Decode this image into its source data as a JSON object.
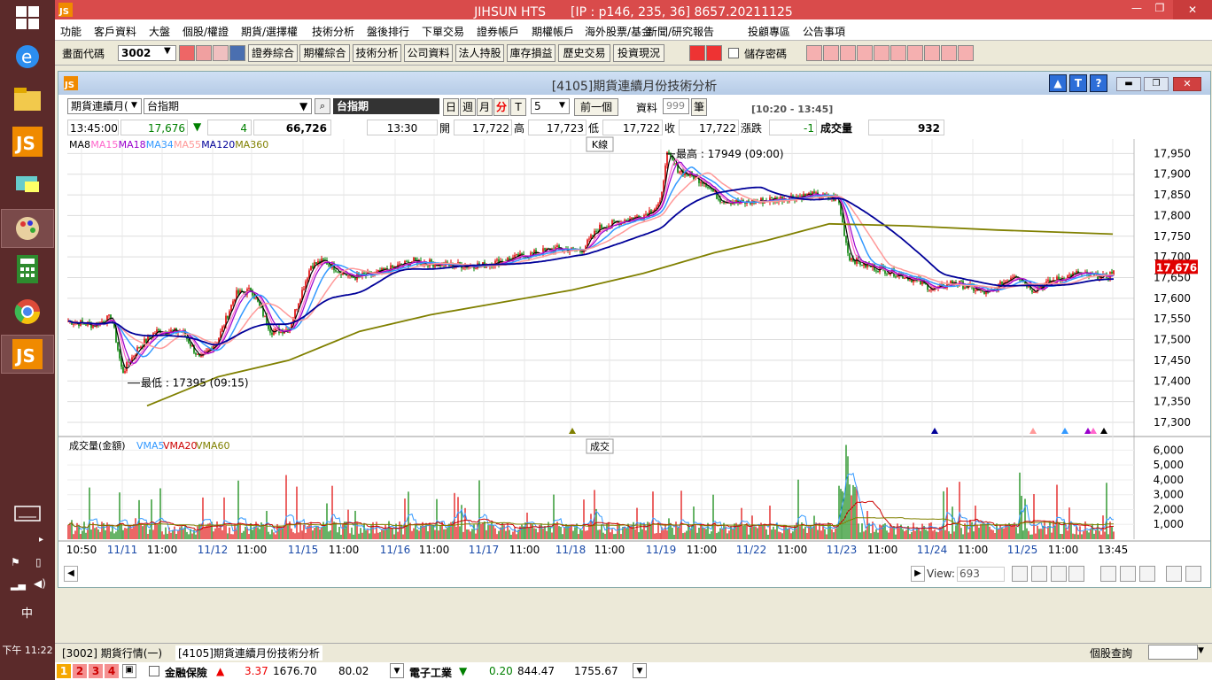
{
  "app": {
    "title": "JIHSUN HTS　　[IP : p146, 235, 36] 8657.20211125",
    "close": "✕",
    "max": "❐",
    "min": "—"
  },
  "menu": [
    "功能",
    "客戶資料",
    "大盤",
    "個股/權證",
    "期貨/選擇權",
    "技術分析",
    "盤後排行",
    "下單交易",
    "證券帳戶",
    "期權帳戶",
    "海外股票/基金",
    "新聞/研究報告",
    "投顧專區",
    "公告事項"
  ],
  "toolbar": {
    "code_label": "畫面代碼",
    "code_value": "3002",
    "buttons": [
      "證券綜合",
      "期權綜合",
      "技術分析",
      "公司資料",
      "法人持股",
      "庫存損益",
      "歷史交易",
      "投資現況"
    ],
    "save_pw_label": "儲存密碼"
  },
  "child": {
    "title": "[4105]期貨連續月份技術分析",
    "help": "?",
    "t_btn": "T"
  },
  "controls": {
    "product": "期貨連續月(",
    "symbol": "台指期",
    "symbol2": "台指期",
    "period_day": "日",
    "period_week": "週",
    "period_month": "月",
    "period_min": "分",
    "period_t": "T",
    "period_n": "5",
    "prev_btn": "前一個",
    "data_label": "資料",
    "data_count": "999",
    "bi_label": "筆",
    "session": "[10:20 - 13:45]"
  },
  "quote": {
    "time": "13:45:00",
    "price": "17,676",
    "arrow": "▼",
    "chg": "4",
    "total": "66,726",
    "qtime": "13:30",
    "open_label": "開",
    "open": "17,722",
    "high_label": "高",
    "high": "17,723",
    "low_label": "低",
    "low": "17,722",
    "close_label": "收",
    "close": "17,722",
    "chg_label": "漲跌",
    "chgv": "-1",
    "vol_label": "成交量",
    "vol": "932"
  },
  "ma_legend": [
    {
      "t": "MA8",
      "c": "#000000"
    },
    {
      "t": "MA15",
      "c": "#ff66cc"
    },
    {
      "t": "MA18",
      "c": "#9900cc"
    },
    {
      "t": "MA34",
      "c": "#3399ff"
    },
    {
      "t": "MA55",
      "c": "#ff9999"
    },
    {
      "t": "MA120",
      "c": "#000099"
    },
    {
      "t": "MA360",
      "c": "#808000"
    }
  ],
  "kline_tag": "K線",
  "high_note": "最高 : 17949 (09:00)",
  "low_note": "最低 : 17395 (09:15)",
  "vol_legend": [
    {
      "t": "成交量(金額)",
      "c": "#000000"
    },
    {
      "t": "VMA5",
      "c": "#3399ff"
    },
    {
      "t": "VMA20",
      "c": "#cc0000"
    },
    {
      "t": "VMA60",
      "c": "#808000"
    }
  ],
  "vol_tag": "成交",
  "price_axis": [
    "17,950",
    "17,900",
    "17,850",
    "17,800",
    "17,750",
    "17,700",
    "17,650",
    "17,600",
    "17,550",
    "17,500",
    "17,450",
    "17,400",
    "17,350",
    "17,300"
  ],
  "last_price": "17,676",
  "vol_axis": [
    "6,000",
    "5,000",
    "4,000",
    "3,000",
    "2,000",
    "1,000"
  ],
  "time_axis": [
    "10:50",
    "11/11",
    "11:00",
    "11/12",
    "11:00",
    "11/15",
    "11:00",
    "11/16",
    "11:00",
    "11/17",
    "11:00",
    "11/18",
    "11:00",
    "11/19",
    "11:00",
    "11/22",
    "11:00",
    "11/23",
    "11:00",
    "11/24",
    "11:00",
    "11/25",
    "11:00",
    "13:45"
  ],
  "view": {
    "label": "View:",
    "value": "693"
  },
  "tabs": [
    "[3002] 期貨行情(一)",
    "[4105]期貨連續月份技術分析"
  ],
  "stock_query": "個股查詢",
  "ticker": {
    "pages": [
      "1",
      "2",
      "3",
      "4"
    ],
    "item1_name": "金融保險",
    "item1_arrow": "▲",
    "item1_chg": "3.37",
    "item1_px": "1676.70",
    "item1_vol": "80.02",
    "item2_name": "電子工業",
    "item2_arrow": "▼",
    "item2_chg": "0.20",
    "item2_px": "844.47",
    "item2_vol": "1755.67"
  },
  "clock": "下午 11:22",
  "ime": "中",
  "colors": {
    "title_red": "#d94b4b",
    "up": "#e00000",
    "down": "#008000"
  }
}
